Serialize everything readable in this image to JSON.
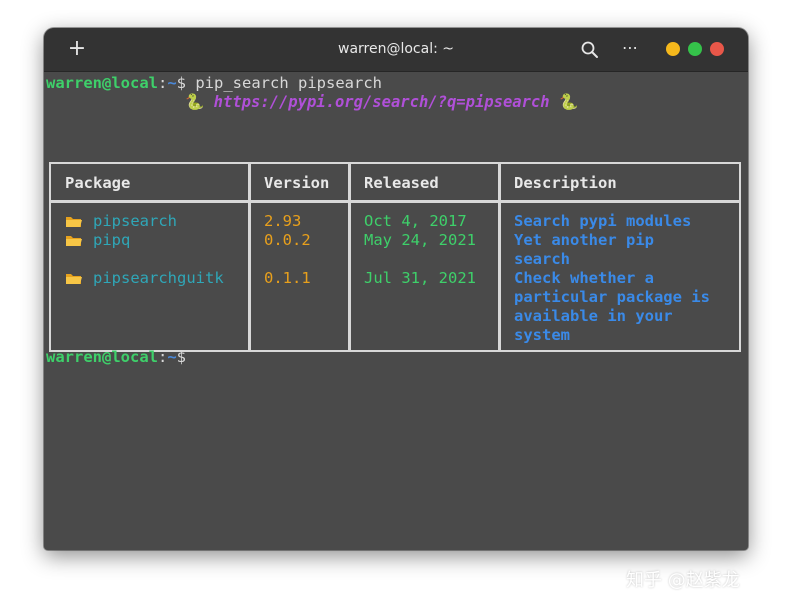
{
  "window": {
    "title": "warren@local: ~",
    "new_tab_glyph": "+",
    "menu_glyph": "⋯",
    "colors": {
      "minimize": "#f5b81c",
      "maximize": "#35c24a",
      "close": "#e85749"
    }
  },
  "terminal": {
    "prompt_user": "warren@local",
    "prompt_sep": ":",
    "prompt_path": "~",
    "prompt_symbol": "$",
    "command": " pip_search pipsearch",
    "banner_url": "https://pypi.org/search/?q=pipsearch",
    "banner_icon": "snake-icon",
    "banner_snake": "🐍"
  },
  "table": {
    "headers": [
      "Package",
      "Version",
      "Released",
      "Description"
    ],
    "rows": [
      {
        "package": "pipsearch",
        "version": "2.93",
        "released": "Oct 4, 2017",
        "description": [
          "Search pypi modules"
        ]
      },
      {
        "package": "pipq",
        "version": "0.0.2",
        "released": "May 24, 2021",
        "description": [
          "Yet another pip",
          "search"
        ]
      },
      {
        "package": "pipsearchguitk",
        "version": "0.1.1",
        "released": "Jul 31, 2021",
        "description": [
          "Check whether a",
          "particular package is",
          "available in your",
          "system"
        ]
      }
    ],
    "folder_icon": "folder-icon",
    "colors": {
      "package": "#2fa7b8",
      "version": "#e8a01c",
      "released": "#3ed06a",
      "description": "#3a8ae8"
    }
  },
  "watermark": "知乎 @赵紫龙"
}
